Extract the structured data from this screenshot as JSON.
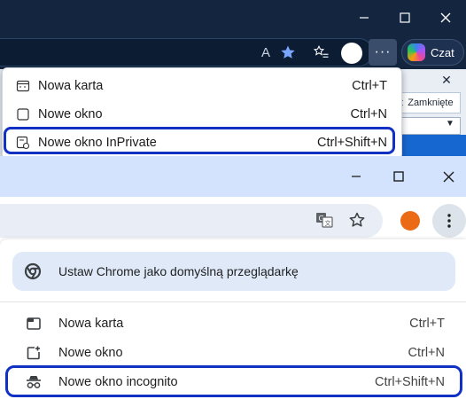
{
  "edge": {
    "read_aloud_glyph": "A",
    "copilot_label": "Czat",
    "more_glyph": "···",
    "menu_items": [
      {
        "label": "Nowa karta",
        "shortcut": "Ctrl+T",
        "icon": "new-tab-icon"
      },
      {
        "label": "Nowe okno",
        "shortcut": "Ctrl+N",
        "icon": "new-window-icon"
      },
      {
        "label": "Nowe okno InPrivate",
        "shortcut": "Ctrl+Shift+N",
        "icon": "inprivate-window-icon"
      }
    ],
    "background_close_label": "Zamknięte",
    "highlight_color": "#1130c4"
  },
  "chrome": {
    "default_browser_prompt": "Ustaw Chrome jako domyślną przeglądarkę",
    "menu_items": [
      {
        "label": "Nowa karta",
        "shortcut": "Ctrl+T",
        "icon": "new-tab-icon"
      },
      {
        "label": "Nowe okno",
        "shortcut": "Ctrl+N",
        "icon": "new-window-icon"
      },
      {
        "label": "Nowe okno incognito",
        "shortcut": "Ctrl+Shift+N",
        "icon": "incognito-icon"
      }
    ],
    "avatar_color": "#ea6a16",
    "titlebar_color": "#d3e3fd",
    "highlight_color": "#1130c4"
  }
}
